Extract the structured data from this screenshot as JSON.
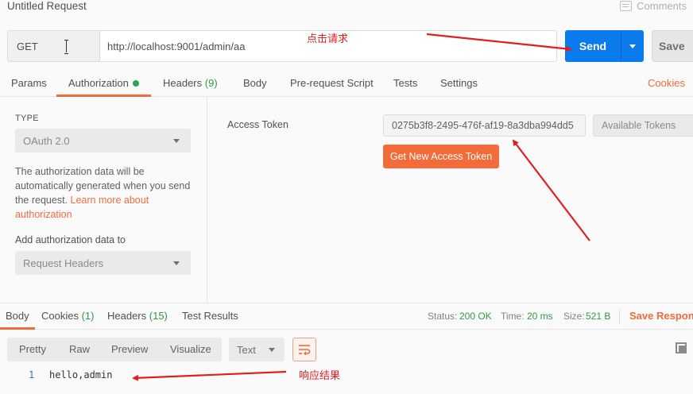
{
  "header": {
    "title": "Untitled Request",
    "comments_label": "Comments"
  },
  "request": {
    "method": "GET",
    "url": "http://localhost:9001/admin/aa",
    "send_label": "Send",
    "save_label": "Save"
  },
  "tabs": {
    "params": "Params",
    "authorization": "Authorization",
    "headers": "Headers",
    "headers_count": "(9)",
    "body": "Body",
    "prerequest": "Pre-request Script",
    "tests": "Tests",
    "settings": "Settings",
    "cookies": "Cookies"
  },
  "auth": {
    "type_label": "TYPE",
    "type_value": "OAuth 2.0",
    "desc_text": "The authorization data will be automatically generated when you send the request. ",
    "desc_link": "Learn more about authorization",
    "add_to_label": "Add authorization data to",
    "add_to_value": "Request Headers",
    "access_token_label": "Access Token",
    "access_token_value": "0275b3f8-2495-476f-af19-8a3dba994dd5",
    "available_tokens": "Available Tokens",
    "get_new_token": "Get New Access Token"
  },
  "response": {
    "tabs": {
      "body": "Body",
      "cookies": "Cookies",
      "cookies_count": "(1)",
      "headers": "Headers",
      "headers_count": "(15)",
      "test_results": "Test Results"
    },
    "status_label": "Status:",
    "status_value": "200 OK",
    "time_label": "Time:",
    "time_value": "20 ms",
    "size_label": "Size:",
    "size_value": "521 B",
    "save_response": "Save Response",
    "view_modes": [
      "Pretty",
      "Raw",
      "Preview",
      "Visualize"
    ],
    "format": "Text",
    "line_number": "1",
    "line_text": "hello,admin"
  },
  "annotations": {
    "click_request": "点击请求",
    "response_result": "响应结果"
  },
  "colors": {
    "accent": "#f26b3a",
    "send": "#097bed",
    "success": "#2d9a45",
    "annotation": "#e02020"
  }
}
